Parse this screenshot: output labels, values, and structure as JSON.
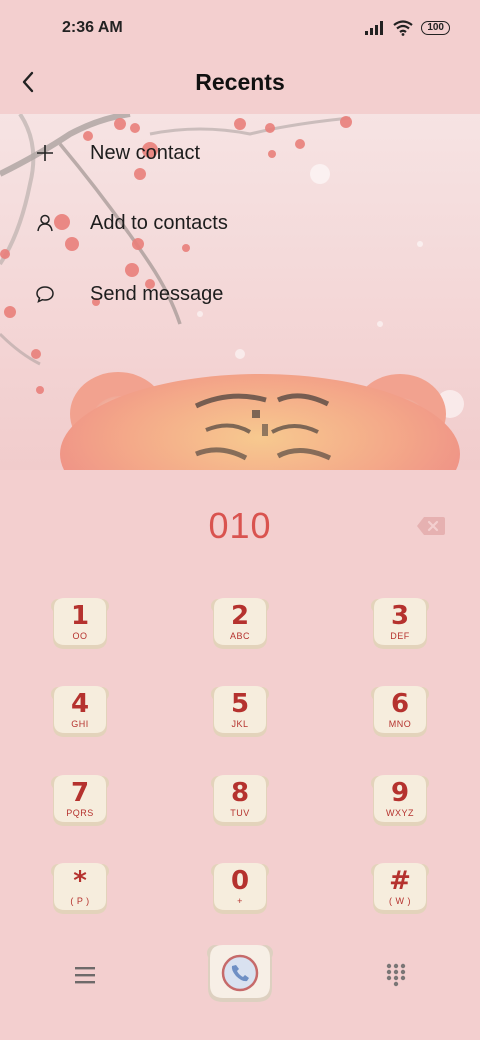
{
  "status": {
    "time": "2:36 AM",
    "battery": "100",
    "icons": [
      "signal-icon",
      "wifi-icon",
      "battery-icon"
    ]
  },
  "header": {
    "title": "Recents",
    "back_icon": "chevron-left-icon"
  },
  "menu": {
    "items": [
      {
        "label": "New contact",
        "icon": "plus-icon"
      },
      {
        "label": "Add to contacts",
        "icon": "person-icon"
      },
      {
        "label": "Send message",
        "icon": "message-bubble-icon"
      }
    ]
  },
  "dialer": {
    "number": "010",
    "backspace_icon": "backspace-icon"
  },
  "keypad": {
    "keys": [
      {
        "digit": "1",
        "letters": "OO"
      },
      {
        "digit": "2",
        "letters": "ABC"
      },
      {
        "digit": "3",
        "letters": "DEF"
      },
      {
        "digit": "4",
        "letters": "GHI"
      },
      {
        "digit": "5",
        "letters": "JKL"
      },
      {
        "digit": "6",
        "letters": "MNO"
      },
      {
        "digit": "7",
        "letters": "PQRS"
      },
      {
        "digit": "8",
        "letters": "TUV"
      },
      {
        "digit": "9",
        "letters": "WXYZ"
      },
      {
        "digit": "*",
        "letters": "( P )"
      },
      {
        "digit": "0",
        "letters": "+"
      },
      {
        "digit": "#",
        "letters": "( W )"
      }
    ]
  },
  "bottom": {
    "menu_icon": "hamburger-menu-icon",
    "call_icon": "phone-icon",
    "dialpad_icon": "dialpad-grid-icon"
  },
  "colors": {
    "background": "#f3cfcf",
    "digits": "#b5322e",
    "number": "#d9534f",
    "key_face": "#f4ead9"
  }
}
